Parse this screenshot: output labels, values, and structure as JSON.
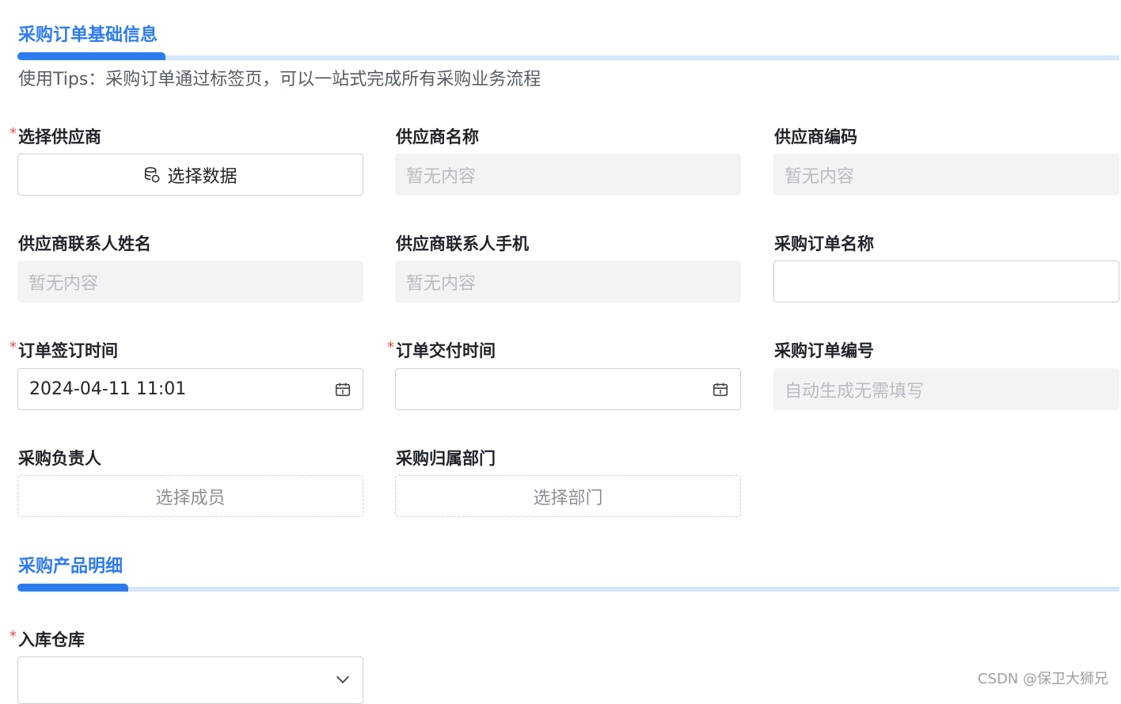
{
  "section1": {
    "title": "采购订单基础信息"
  },
  "tips": "使用Tips：采购订单通过标签页，可以一站式完成所有采购业务流程",
  "required_mark": "*",
  "fields": {
    "supplier_select": {
      "label": "选择供应商",
      "button_text": "选择数据"
    },
    "supplier_name": {
      "label": "供应商名称",
      "value": "暂无内容"
    },
    "supplier_code": {
      "label": "供应商编码",
      "value": "暂无内容"
    },
    "supplier_contact_name": {
      "label": "供应商联系人姓名",
      "value": "暂无内容"
    },
    "supplier_contact_phone": {
      "label": "供应商联系人手机",
      "value": "暂无内容"
    },
    "order_name": {
      "label": "采购订单名称",
      "value": ""
    },
    "sign_time": {
      "label": "订单签订时间",
      "value": "2024-04-11 11:01"
    },
    "delivery_time": {
      "label": "订单交付时间",
      "value": ""
    },
    "order_number": {
      "label": "采购订单编号",
      "value": "自动生成无需填写"
    },
    "owner": {
      "label": "采购负责人",
      "button_text": "选择成员"
    },
    "department": {
      "label": "采购归属部门",
      "button_text": "选择部门"
    },
    "warehouse": {
      "label": "入库仓库",
      "value": ""
    }
  },
  "section2": {
    "title": "采购产品明细"
  },
  "watermark": "CSDN @保卫大狮兄",
  "icons": {
    "select_data": "database-icon",
    "sign_time": "calendar-icon",
    "delivery_time": "calendar-icon",
    "warehouse": "chevron-down-icon"
  },
  "colors": {
    "accent": "#2d7bf0",
    "required": "#e84a4a",
    "readonly_bg": "#f2f3f5"
  }
}
